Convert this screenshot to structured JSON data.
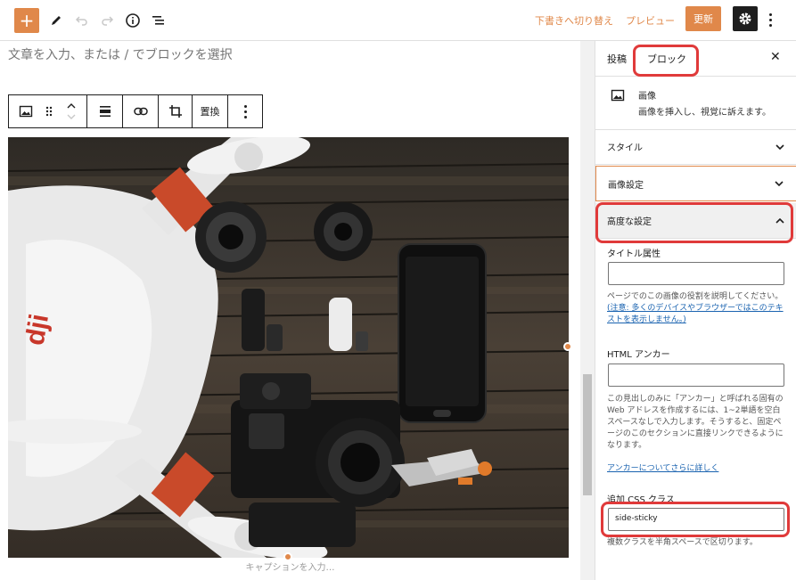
{
  "header": {
    "add_icon": "plus-icon",
    "tools_icon": "pencil-icon",
    "undo_icon": "undo-icon",
    "redo_icon": "redo-icon",
    "info_icon": "info-icon",
    "outline_icon": "list-view-icon",
    "save_draft_label": "下書きへ切り替え",
    "preview_label": "プレビュー",
    "update_label": "更新",
    "settings_icon": "gear-icon",
    "more_icon": "more-vertical-icon"
  },
  "editor": {
    "placeholder": "文章を入力、または / でブロックを選択",
    "toolbar": {
      "replace_label": "置換"
    },
    "caption_placeholder": "キャプションを入力…"
  },
  "sidebar": {
    "tabs": [
      "投稿",
      "ブロック"
    ],
    "active_tab": "ブロック",
    "block_title": "画像",
    "block_description": "画像を挿入し、視覚に訴えます。",
    "panels": {
      "styles": "スタイル",
      "image_settings": "画像設定",
      "advanced": "高度な設定"
    },
    "title_attr_label": "タイトル属性",
    "title_attr_help_prefix": "ページでのこの画像の役割を説明してください。",
    "title_attr_help_link": "(注意: 多くのデバイスやブラウザーではこのテキストを表示しません。)",
    "html_anchor_label": "HTML アンカー",
    "html_anchor_help": "この見出しのみに「アンカー」と呼ばれる固有の Web アドレスを作成するには、1~2単語を空白スペースなしで入力します。そうすると、固定ページのこのセクションに直接リンクできるようになります。",
    "anchor_more_link": "アンカーについてさらに詳しく",
    "css_class_label": "追加 CSS クラス",
    "css_class_value": "side-sticky",
    "css_class_help": "複数クラスを半角スペースで区切ります。"
  },
  "colors": {
    "accent": "#e0884a",
    "highlight": "#e03a3a",
    "link": "#1a63b0"
  }
}
